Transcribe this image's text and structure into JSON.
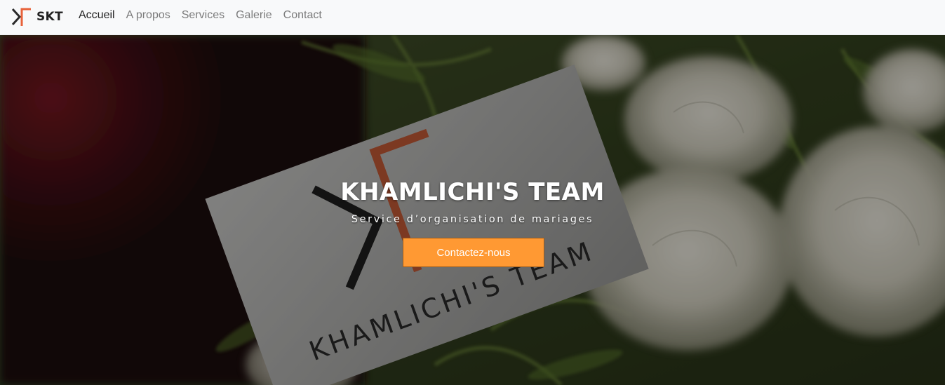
{
  "navbar": {
    "brand_text": "SKT",
    "links": [
      "Accueil",
      "A propos",
      "Services",
      "Galerie",
      "Contact"
    ],
    "active_index": 0
  },
  "hero": {
    "title": "KHAMLICHI'S TEAM",
    "subtitle": "Service d’organisation de mariages",
    "cta_label": "Contactez-nous",
    "card_text": "KHAMLICHI'S TEAM"
  },
  "colors": {
    "accent": "#ff9933",
    "logo_orange": "#e8623a",
    "nav_bg": "#f8f9fa"
  }
}
